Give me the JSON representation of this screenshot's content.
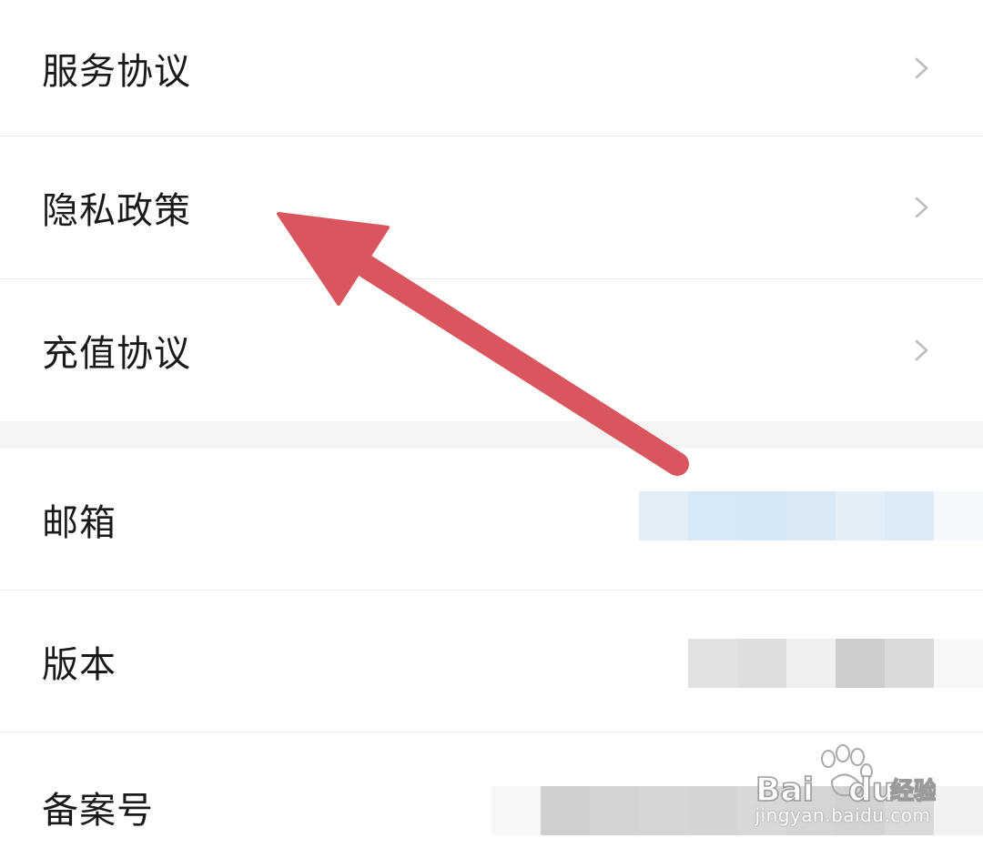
{
  "links": [
    {
      "label": "服务协议"
    },
    {
      "label": "隐私政策"
    },
    {
      "label": "充值协议"
    }
  ],
  "info": [
    {
      "label": "邮箱"
    },
    {
      "label": "版本"
    },
    {
      "label": "备案号"
    }
  ],
  "watermark": {
    "url": "jingyan.baidu.com"
  },
  "colors": {
    "arrow": "#d9565e",
    "chevron": "#bdbdbd",
    "divider": "#ececec",
    "section_gap": "#f5f5f5",
    "text": "#1a1a1a"
  },
  "icons": {
    "chevron": "chevron-right-icon",
    "arrow": "annotation-arrow-icon",
    "watermark": "baidu-paw-logo"
  }
}
